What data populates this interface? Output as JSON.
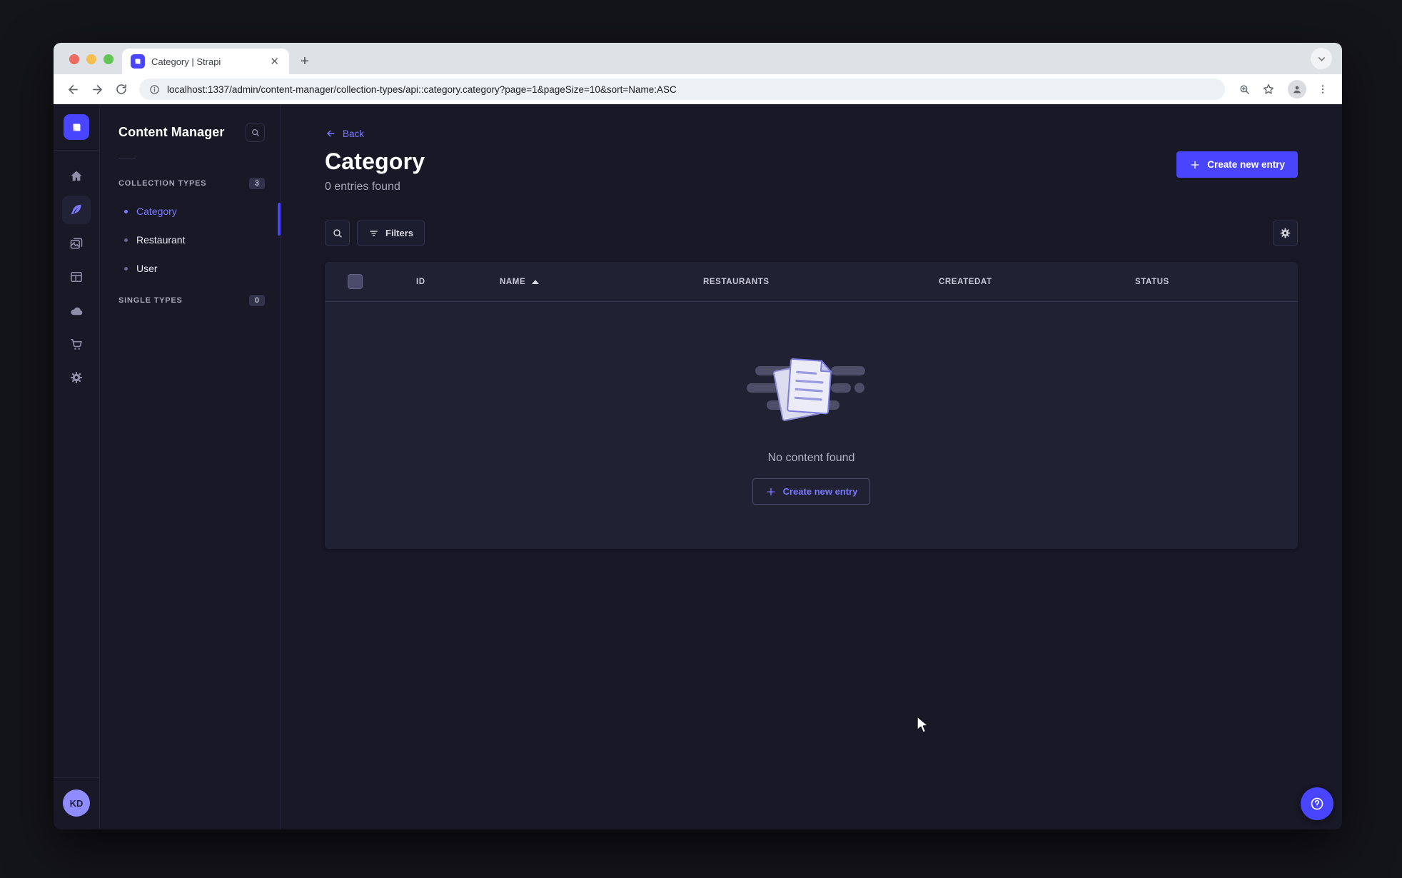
{
  "browser": {
    "tab_title": "Category | Strapi",
    "url": "localhost:1337/admin/content-manager/collection-types/api::category.category?page=1&pageSize=10&sort=Name:ASC"
  },
  "nav": {
    "title": "Content Manager",
    "collection_types_label": "COLLECTION TYPES",
    "collection_types_count": "3",
    "single_types_label": "SINGLE TYPES",
    "single_types_count": "0",
    "items": [
      {
        "label": "Category"
      },
      {
        "label": "Restaurant"
      },
      {
        "label": "User"
      }
    ]
  },
  "page": {
    "back_label": "Back",
    "title": "Category",
    "subtitle": "0 entries found",
    "create_button_label": "Create new entry",
    "filters_label": "Filters"
  },
  "table": {
    "columns": [
      "ID",
      "NAME",
      "RESTAURANTS",
      "CREATEDAT",
      "STATUS"
    ],
    "sorted_column": "NAME",
    "empty_title": "No content found",
    "empty_button_label": "Create new entry"
  },
  "user": {
    "initials": "KD"
  },
  "colors": {
    "accent": "#4945ff",
    "accent_light": "#7b79ff",
    "app_background": "#181826",
    "card_background": "#212134"
  }
}
